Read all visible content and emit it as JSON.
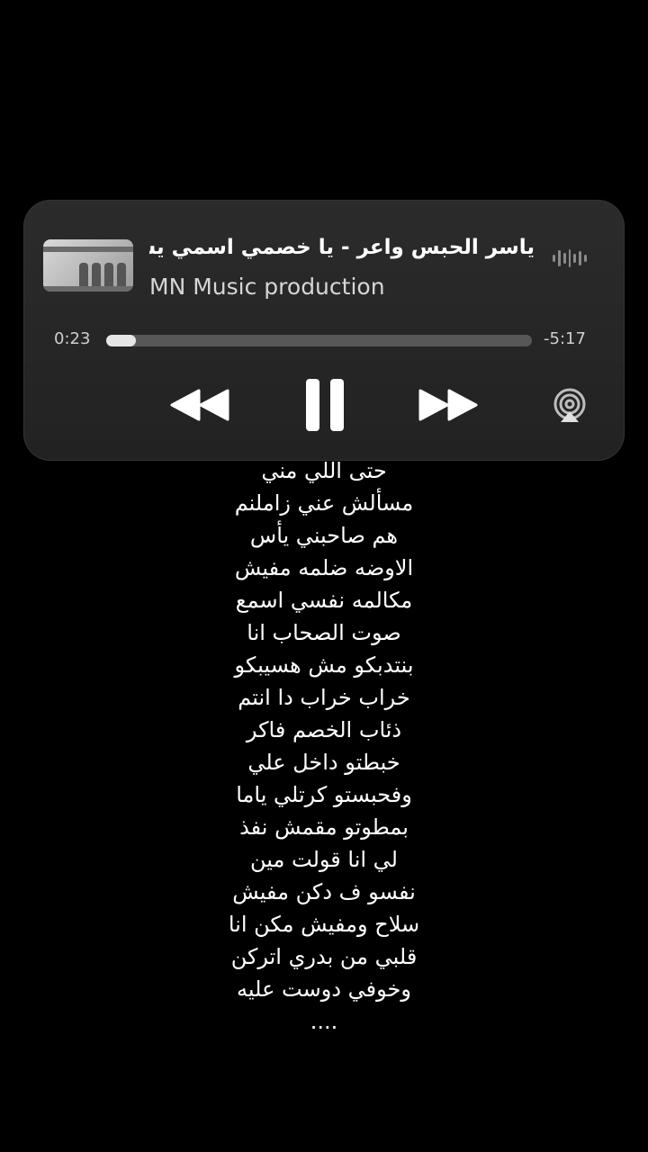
{
  "player": {
    "title": "ياسر الحبس واعر - يا خصمي اسمي يشرفك",
    "artist": "MN Music production",
    "elapsed": "0:23",
    "remaining": "-5:17",
    "progress_fraction": 0.07
  },
  "icons": {
    "artwork": "album-art-icon",
    "equalizer": "equalizer-icon",
    "rewind": "rewind-icon",
    "pause": "pause-icon",
    "forward": "fast-forward-icon",
    "airplay": "airplay-icon"
  },
  "lyrics": [
    "حتى اللي مني",
    "مسألش عني زاملنم",
    "هم صاحبني يأس",
    "الاوضه ضلمه مفيش",
    "مكالمه نفسي اسمع",
    "صوت الصحاب انا",
    "بنتدبكو مش هسيبكو",
    "خراب خراب دا انتم",
    "ذئاب الخصم فاكر",
    "خبطتو داخل علي",
    "وفحبستو كرتلي ياما",
    "بمطوتو مقمش نفذ",
    "لي انا قولت مين",
    "نفسو ف دكن مفيش",
    "سلاح ومفيش مكن انا",
    "قلبي من بدري اتركن",
    "وخوفي دوست عليه",
    "...."
  ]
}
